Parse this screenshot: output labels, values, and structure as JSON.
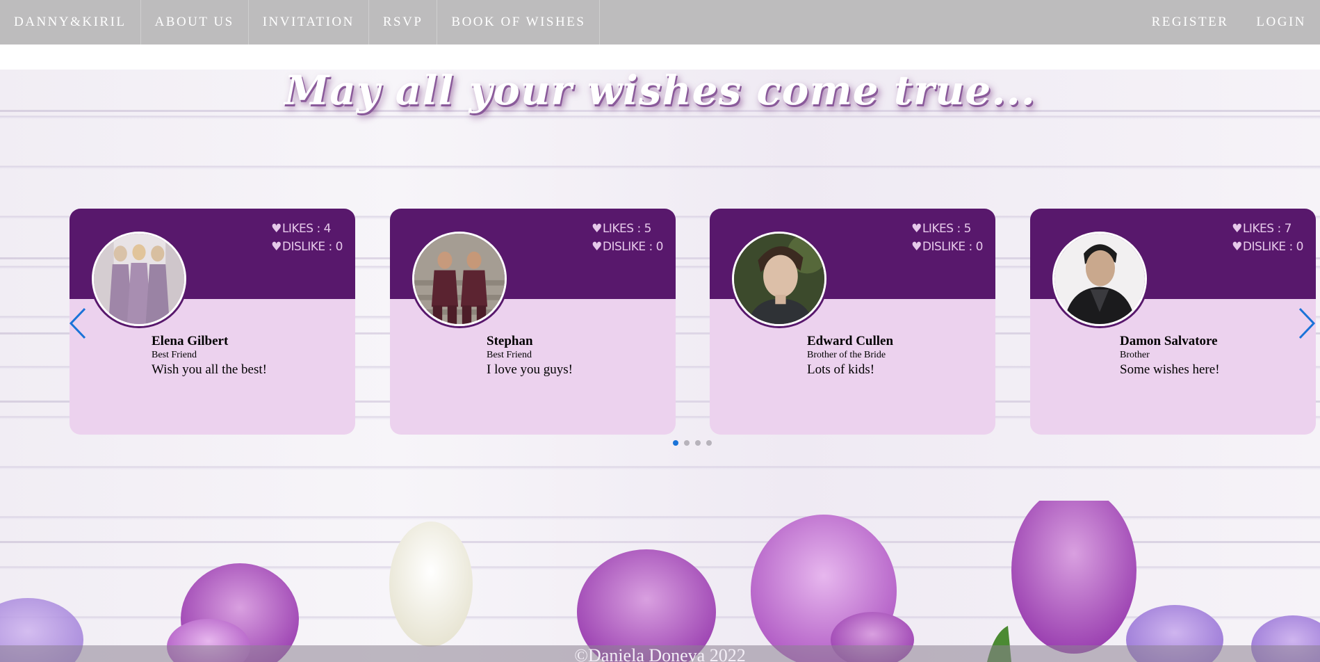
{
  "nav": {
    "brand": "DANNY&KIRIL",
    "links": [
      "ABOUT US",
      "INVITATION",
      "RSVP",
      "BOOK OF WISHES"
    ],
    "register": "REGISTER",
    "login": "LOGIN"
  },
  "heading": "May all your wishes come true...",
  "cards": [
    {
      "likes": "LIKES : 4",
      "dislikes": "DISLIKE : 0",
      "name": "Elena Gilbert",
      "relation": "Best Friend",
      "wish": "Wish you all the best!"
    },
    {
      "likes": "LIKES : 5",
      "dislikes": "DISLIKE : 0",
      "name": "Stephan",
      "relation": "Best Friend",
      "wish": "I love you guys!"
    },
    {
      "likes": "LIKES : 5",
      "dislikes": "DISLIKE : 0",
      "name": "Edward Cullen",
      "relation": "Brother of the Bride",
      "wish": "Lots of kids!"
    },
    {
      "likes": "LIKES : 7",
      "dislikes": "DISLIKE : 0",
      "name": "Damon Salvatore",
      "relation": "Brother",
      "wish": "Some wishes here!"
    }
  ],
  "carousel": {
    "pages": 4,
    "active_page": 1
  },
  "footer": "©Daniela Doneva 2022",
  "colors": {
    "nav_bg": "#bdbcbd",
    "card_top": "#58186c",
    "card_bottom": "#ecd2ee",
    "accent": "#1a73d8"
  },
  "icons": {
    "stat_icon": "heart-icon",
    "prev": "chevron-left-icon",
    "next": "chevron-right-icon"
  }
}
